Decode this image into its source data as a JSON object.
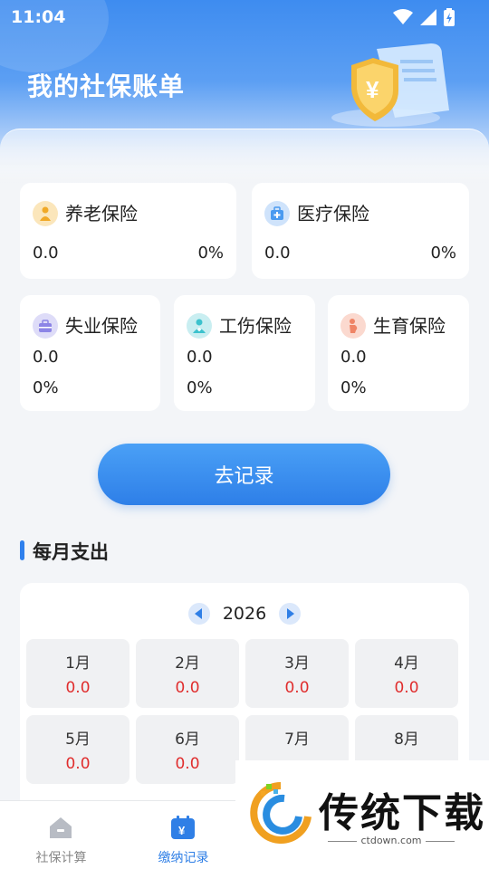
{
  "status_bar": {
    "time": "11:04"
  },
  "header": {
    "title": "我的社保账单"
  },
  "insurance": {
    "pension": {
      "name": "养老保险",
      "amount": "0.0",
      "percent": "0%",
      "icon": "pension-icon",
      "color": "#f4c266"
    },
    "medical": {
      "name": "医疗保险",
      "amount": "0.0",
      "percent": "0%",
      "icon": "medical-kit-icon",
      "color": "#6fb0f3"
    },
    "unemployment": {
      "name": "失业保险",
      "amount": "0.0",
      "percent": "0%",
      "icon": "briefcase-icon",
      "color": "#9a93ea"
    },
    "injury": {
      "name": "工伤保险",
      "amount": "0.0",
      "percent": "0%",
      "icon": "injured-person-icon",
      "color": "#5ecfd8"
    },
    "maternity": {
      "name": "生育保险",
      "amount": "0.0",
      "percent": "0%",
      "icon": "maternity-icon",
      "color": "#f49e86"
    }
  },
  "record_button": {
    "label": "去记录"
  },
  "monthly": {
    "title": "每月支出",
    "year": "2026",
    "months": [
      {
        "label": "1月",
        "amount": "0.0"
      },
      {
        "label": "2月",
        "amount": "0.0"
      },
      {
        "label": "3月",
        "amount": "0.0"
      },
      {
        "label": "4月",
        "amount": "0.0"
      },
      {
        "label": "5月",
        "amount": "0.0"
      },
      {
        "label": "6月",
        "amount": "0.0"
      },
      {
        "label": "7月",
        "amount": ""
      },
      {
        "label": "8月",
        "amount": ""
      }
    ]
  },
  "tabbar": {
    "tabs": [
      {
        "label": "社保计算",
        "icon": "house-icon",
        "active": false
      },
      {
        "label": "缴纳记录",
        "icon": "calendar-yuan-icon",
        "active": true
      }
    ],
    "active_color": "#2f7fe6",
    "inactive_color": "#888888"
  },
  "watermark": {
    "brand": "传统下载",
    "url": "ctdown.com"
  }
}
